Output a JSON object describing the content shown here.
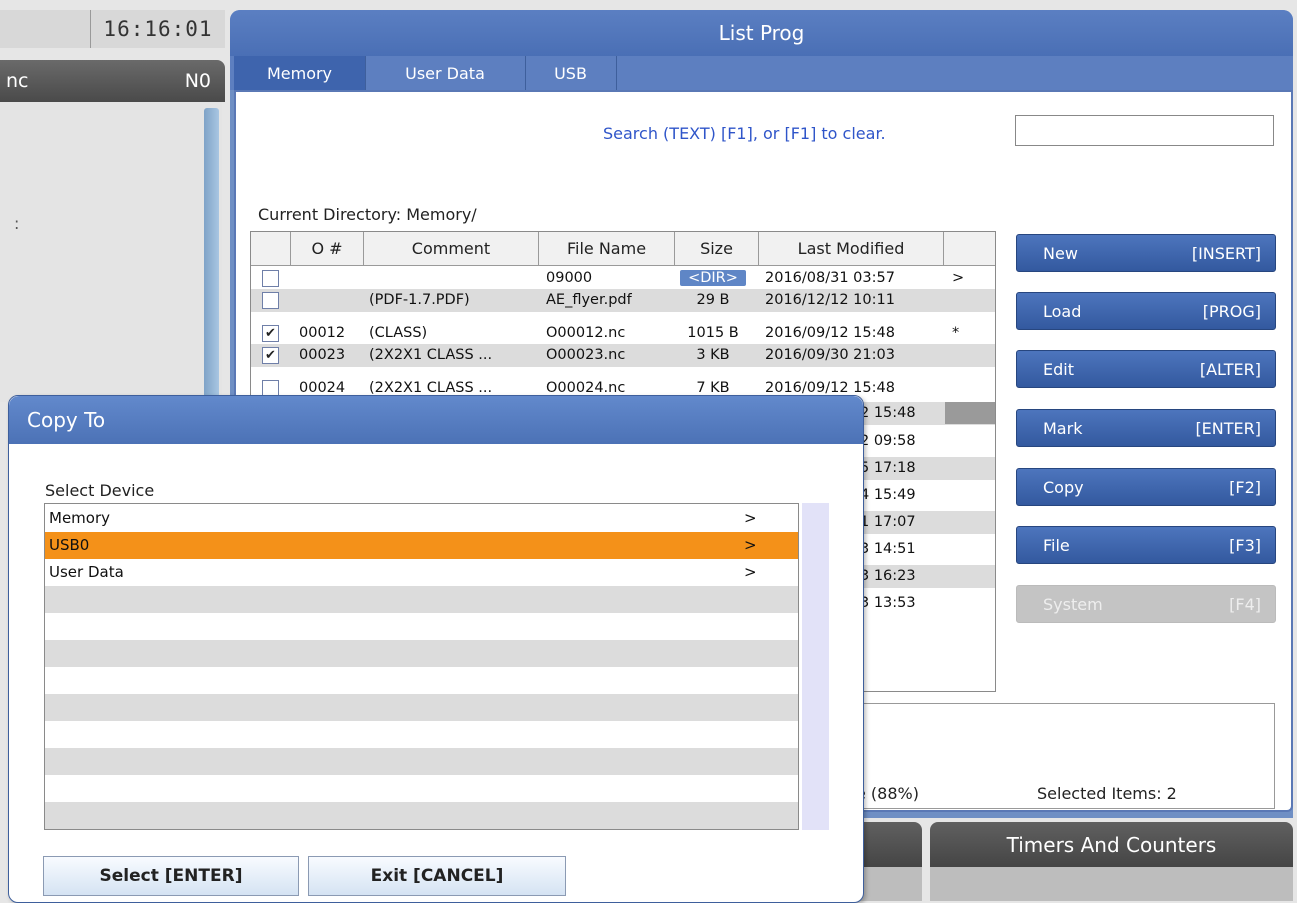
{
  "clock": "16:16:01",
  "left_panel": {
    "header_left": "nc",
    "header_right": "N0",
    "colon": ":"
  },
  "list_prog": {
    "title": "List Prog",
    "tabs": [
      {
        "label": "Memory"
      },
      {
        "label": "User Data"
      },
      {
        "label": "USB"
      }
    ],
    "search_label": "Search (TEXT) [F1], or [F1] to clear.",
    "search_value": "",
    "current_directory": "Current Directory: Memory/",
    "columns": [
      "",
      "O #",
      "Comment",
      "File Name",
      "Size",
      "Last Modified",
      ""
    ],
    "rows": [
      {
        "checked": false,
        "onum": "",
        "comment": "",
        "file": "09000",
        "size": "<DIR>",
        "modified": "2016/08/31 03:57",
        "flag": ">"
      },
      {
        "checked": false,
        "onum": "",
        "comment": "(PDF-1.7.PDF)",
        "file": "AE_flyer.pdf",
        "size": "29 B",
        "modified": "2016/12/12 10:11",
        "flag": ""
      },
      {
        "checked": true,
        "onum": "00012",
        "comment": "(CLASS)",
        "file": "O00012.nc",
        "size": "1015 B",
        "modified": "2016/09/12 15:48",
        "flag": "*"
      },
      {
        "checked": true,
        "onum": "00023",
        "comment": "(2X2X1 CLASS ...",
        "file": "O00023.nc",
        "size": "3 KB",
        "modified": "2016/09/30 21:03",
        "flag": ""
      },
      {
        "checked": false,
        "onum": "00024",
        "comment": "(2X2X1 CLASS ...",
        "file": "O00024.nc",
        "size": "7 KB",
        "modified": "2016/09/12 15:48",
        "flag": ""
      }
    ],
    "partial_times": [
      "2 15:48",
      "2 09:58",
      "5 17:18",
      "4 15:49",
      "1 17:07",
      "3 14:51",
      "3 16:23",
      "3 13:53"
    ],
    "buttons": [
      {
        "label": "New",
        "key": "[INSERT]",
        "disabled": false
      },
      {
        "label": "Load",
        "key": "[PROG]",
        "disabled": false
      },
      {
        "label": "Edit",
        "key": "[ALTER]",
        "disabled": false
      },
      {
        "label": "Mark",
        "key": "[ENTER]",
        "disabled": false
      },
      {
        "label": "Copy",
        "key": "[F2]",
        "disabled": false
      },
      {
        "label": "File",
        "key": "[F3]",
        "disabled": false
      },
      {
        "label": "System",
        "key": "[F4]",
        "disabled": true
      }
    ],
    "status_left": "e (88%)",
    "status_right": "Selected Items: 2"
  },
  "bottom_tab": "Timers And Counters",
  "copy_dialog": {
    "title": "Copy To",
    "select_label": "Select Device",
    "devices": [
      {
        "name": "Memory",
        "arrow": ">",
        "selected": false
      },
      {
        "name": "USB0",
        "arrow": ">",
        "selected": true
      },
      {
        "name": "User Data",
        "arrow": ">",
        "selected": false
      }
    ],
    "select_button": "Select [ENTER]",
    "exit_button": "Exit [CANCEL]"
  }
}
